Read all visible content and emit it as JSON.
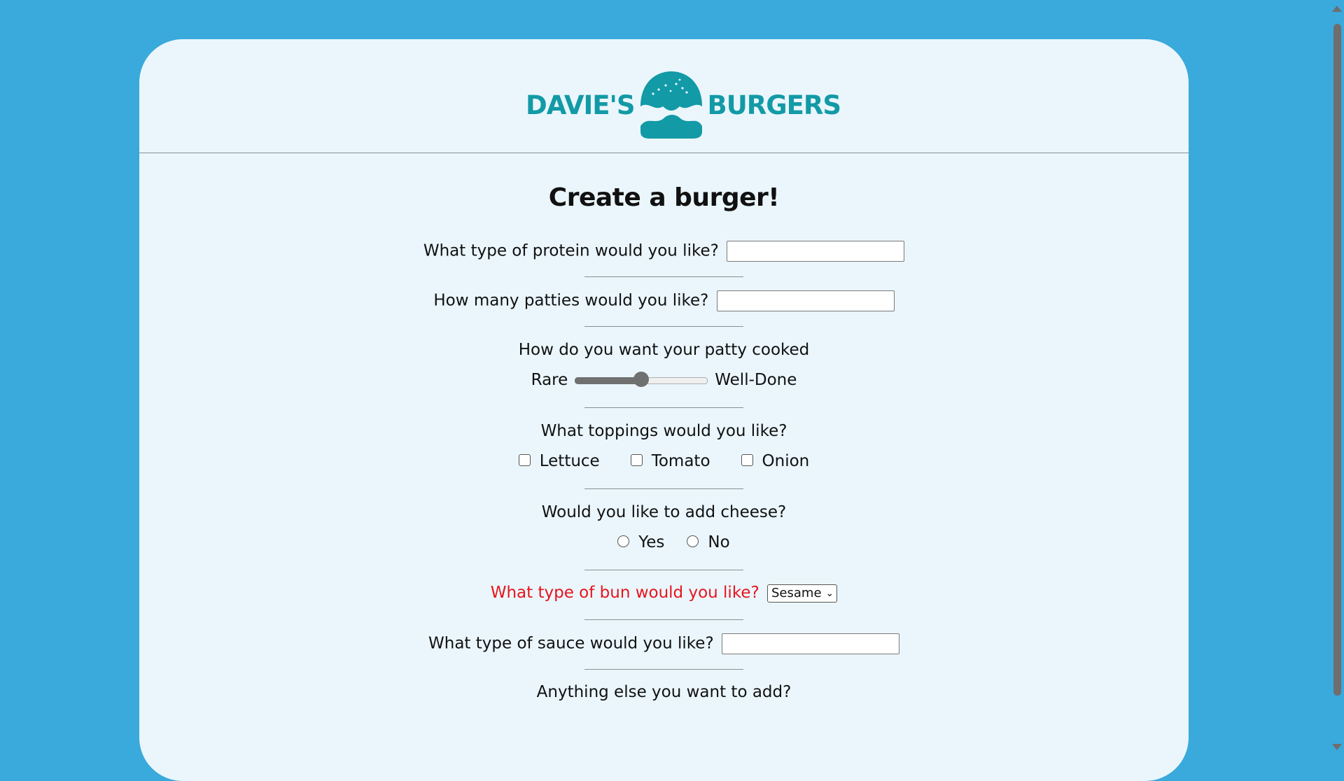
{
  "logo": {
    "left": "DAVIE'S",
    "right": "BURGERS"
  },
  "form": {
    "title": "Create a burger!",
    "protein_label": "What type of protein would you like?",
    "protein_value": "",
    "patties_label": "How many patties would you like?",
    "patties_value": "",
    "cooked_label": "How do you want your patty cooked",
    "cooked_min": "Rare",
    "cooked_max": "Well-Done",
    "cooked_level": 0.5,
    "toppings_label": "What toppings would you like?",
    "toppings": [
      "Lettuce",
      "Tomato",
      "Onion"
    ],
    "cheese_label": "Would you like to add cheese?",
    "cheese_options": [
      "Yes",
      "No"
    ],
    "bun_label": "What type of bun would you like?",
    "bun_selected": "Sesame",
    "sauce_label": "What type of sauce would you like?",
    "sauce_value": "",
    "extra_label": "Anything else you want to add?"
  },
  "colors": {
    "background": "#3aa9db",
    "card": "#eaf6fc",
    "brand": "#129aa6",
    "error": "#e8141c"
  }
}
